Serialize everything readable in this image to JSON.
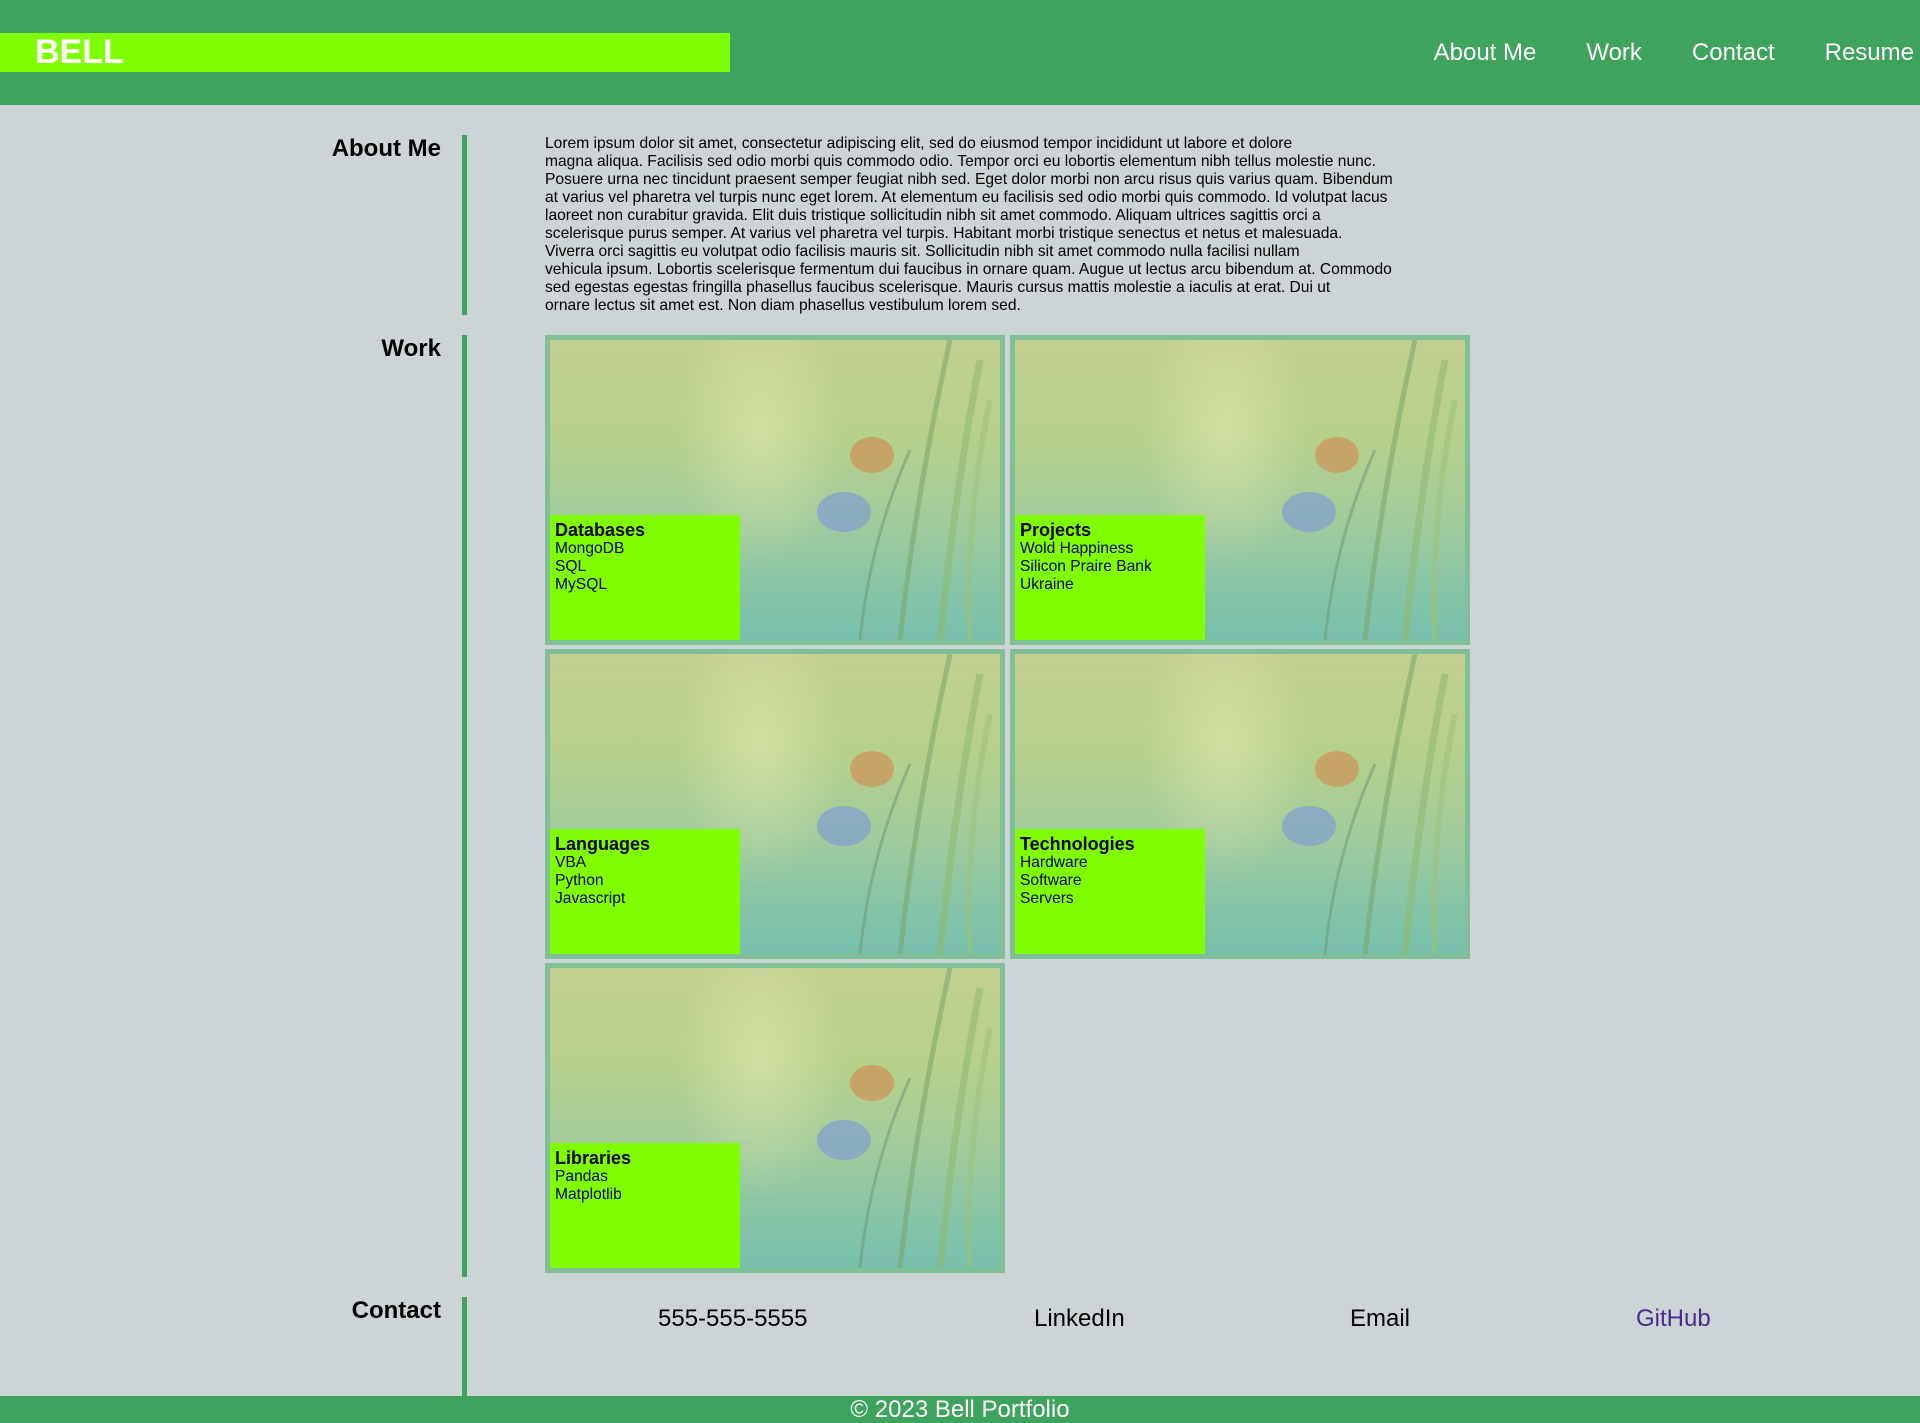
{
  "header": {
    "brand": "BELL",
    "nav": [
      "About Me",
      "Work",
      "Contact",
      "Resume"
    ]
  },
  "about": {
    "title": "About Me",
    "lines": [
      "Lorem ipsum dolor sit amet, consectetur adipiscing elit, sed do eiusmod tempor incididunt ut labore et dolore",
      "magna aliqua. Facilisis sed odio morbi quis commodo odio. Tempor orci eu lobortis elementum nibh tellus molestie nunc.",
      "Posuere urna nec tincidunt praesent semper feugiat nibh sed. Eget dolor morbi non arcu risus quis varius quam. Bibendum",
      "at varius vel pharetra vel turpis nunc eget lorem. At elementum eu facilisis sed odio morbi quis commodo. Id volutpat lacus",
      "laoreet non curabitur gravida. Elit duis tristique sollicitudin nibh sit amet commodo. Aliquam ultrices sagittis orci a",
      "scelerisque purus semper. At varius vel pharetra vel turpis. Habitant morbi tristique senectus et netus et malesuada.",
      "Viverra orci sagittis eu volutpat odio facilisis mauris sit. Sollicitudin nibh sit amet commodo nulla facilisi nullam",
      "vehicula ipsum. Lobortis scelerisque fermentum dui faucibus in ornare quam. Augue ut lectus arcu bibendum at. Commodo",
      "sed egestas egestas fringilla phasellus faucibus scelerisque. Mauris cursus mattis molestie a iaculis at erat. Dui ut",
      "ornare lectus sit amet est. Non diam phasellus vestibulum lorem sed."
    ]
  },
  "work": {
    "title": "Work",
    "cards": [
      {
        "title": "Databases",
        "items": [
          "MongoDB",
          "SQL",
          "MySQL"
        ]
      },
      {
        "title": "Projects",
        "items": [
          "Wold Happiness",
          "Silicon Praire Bank",
          "Ukraine"
        ]
      },
      {
        "title": "Languages",
        "items": [
          "VBA",
          "Python",
          "Javascript"
        ]
      },
      {
        "title": "Technologies",
        "items": [
          "Hardware",
          "Software",
          "Servers"
        ]
      },
      {
        "title": "Libraries",
        "items": [
          "Pandas",
          "Matplotlib"
        ]
      }
    ]
  },
  "contact": {
    "title": "Contact",
    "phone": "555-555-5555",
    "linkedin": "LinkedIn",
    "email": "Email",
    "github": "GitHub"
  },
  "footer": {
    "text": "© 2023 Bell Portfolio"
  },
  "colors": {
    "header_bg": "#3da35d",
    "brand_bg": "#80ff00",
    "page_bg": "#ccd4d5",
    "card_border": "#80bf98",
    "visited_link": "#4b2a8a"
  }
}
